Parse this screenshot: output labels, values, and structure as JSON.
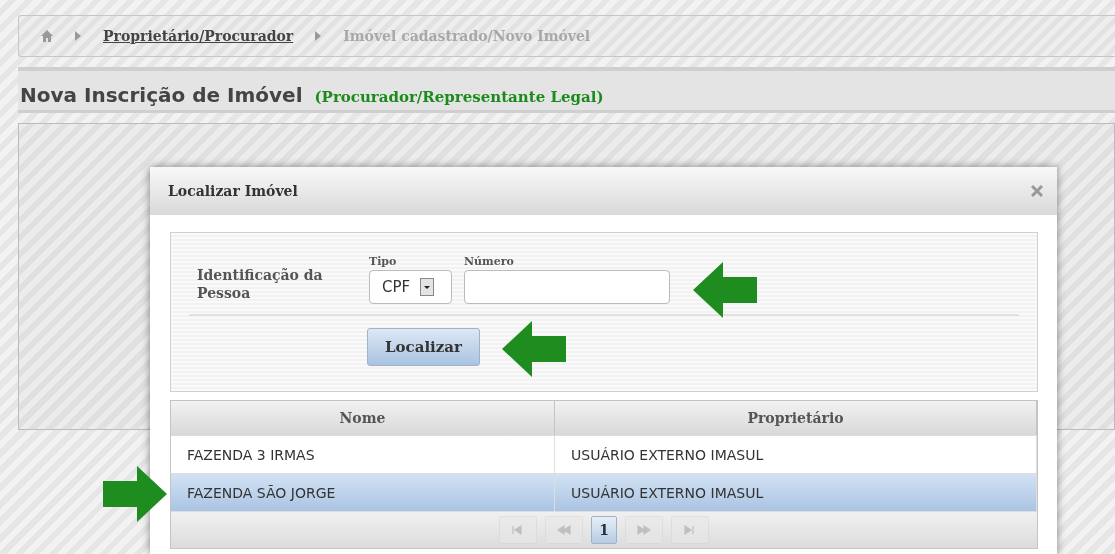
{
  "breadcrumb": [
    {
      "label": "Proprietário/Procurador",
      "current": false
    },
    {
      "label": "Imóvel cadastrado/Novo Imóvel",
      "current": true
    }
  ],
  "page_title": {
    "title": "Nova Inscrição de Imóvel",
    "subtitle": "(Procurador/Representante Legal)"
  },
  "dialog": {
    "title": "Localizar Imóvel",
    "form": {
      "label": "Identificação da Pessoa",
      "tipo": {
        "label": "Tipo",
        "value": "CPF"
      },
      "numero": {
        "label": "Número"
      },
      "button": "Localizar"
    },
    "table": {
      "columns": [
        "Nome",
        "Proprietário"
      ],
      "rows": [
        {
          "cells": [
            "FAZENDA 3 IRMAS",
            "USUÁRIO EXTERNO IMASUL"
          ],
          "selected": false
        },
        {
          "cells": [
            "FAZENDA SÃO JORGE",
            "USUÁRIO EXTERNO IMASUL"
          ],
          "selected": true
        }
      ]
    },
    "pager": {
      "before": [
        {
          "kind": "first",
          "disabled": true
        },
        {
          "kind": "prev",
          "disabled": true
        }
      ],
      "pages": [
        {
          "label": "1",
          "selected": true
        }
      ],
      "after": [
        {
          "kind": "next",
          "disabled": true
        },
        {
          "kind": "last",
          "disabled": true
        }
      ]
    }
  }
}
